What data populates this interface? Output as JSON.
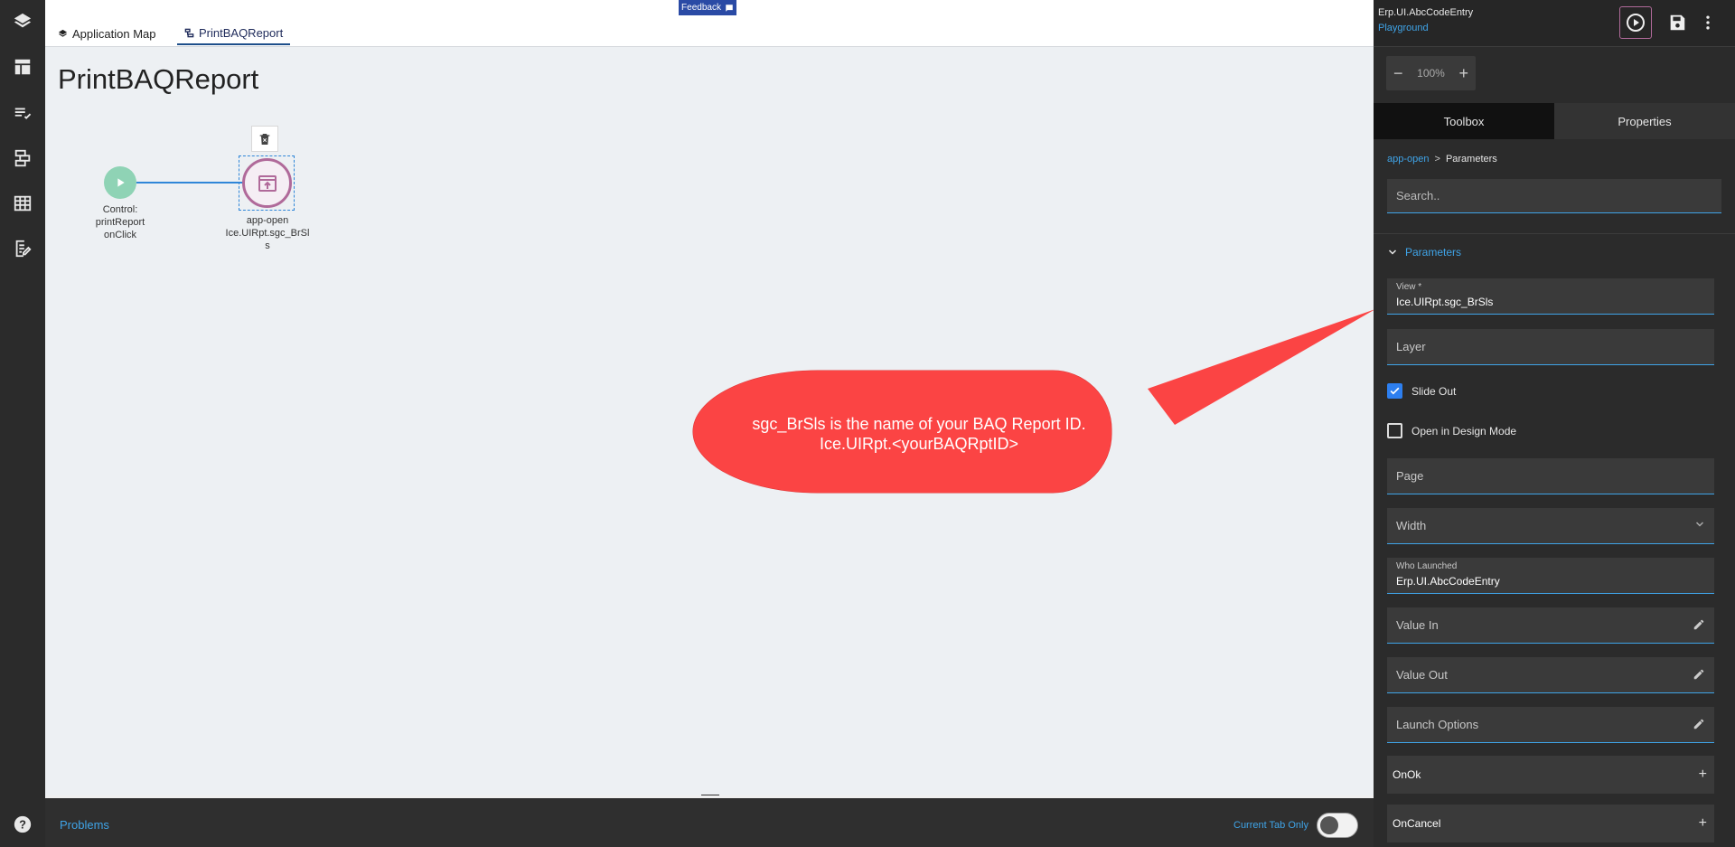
{
  "tabs": [
    {
      "label": "Application Map"
    },
    {
      "label": "PrintBAQReport"
    }
  ],
  "feedback_label": "Feedback",
  "page_title": "PrintBAQReport",
  "flow": {
    "start_node": {
      "label_lines": [
        "Control:",
        "printReport",
        "onClick"
      ]
    },
    "app_node": {
      "label_lines": [
        "app-open",
        "Ice.UIRpt.sgc_BrSl",
        "s"
      ]
    }
  },
  "callout": {
    "line1": "sgc_BrSls is the name of your BAQ Report ID.",
    "line2": "Ice.UIRpt.<yourBAQRptID>",
    "color": "#fb4444"
  },
  "problems": {
    "label": "Problems",
    "current_tab_label": "Current Tab Only"
  },
  "panel": {
    "app_id": "Erp.UI.AbcCodeEntry",
    "app_sub": "Playground",
    "zoom": "100%",
    "tabs": {
      "toolbox": "Toolbox",
      "properties": "Properties"
    },
    "breadcrumb": {
      "parent": "app-open",
      "sep": ">",
      "current": "Parameters"
    },
    "search_placeholder": "Search..",
    "section_label": "Parameters",
    "fields": {
      "view_label": "View *",
      "view_value": "Ice.UIRpt.sgc_BrSls",
      "layer_label": "Layer",
      "slide_out_label": "Slide Out",
      "design_mode_label": "Open in Design Mode",
      "page_label": "Page",
      "width_label": "Width",
      "who_launched_label": "Who Launched",
      "who_launched_value": "Erp.UI.AbcCodeEntry",
      "value_in_label": "Value In",
      "value_out_label": "Value Out",
      "launch_options_label": "Launch Options"
    },
    "events": {
      "on_ok": "OnOk",
      "on_cancel": "OnCancel"
    }
  },
  "colors": {
    "accent": "#3fa4e8",
    "start_node": "#8fd3b5",
    "app_node": "#b06a9a",
    "checkbox": "#2d7ff0"
  }
}
